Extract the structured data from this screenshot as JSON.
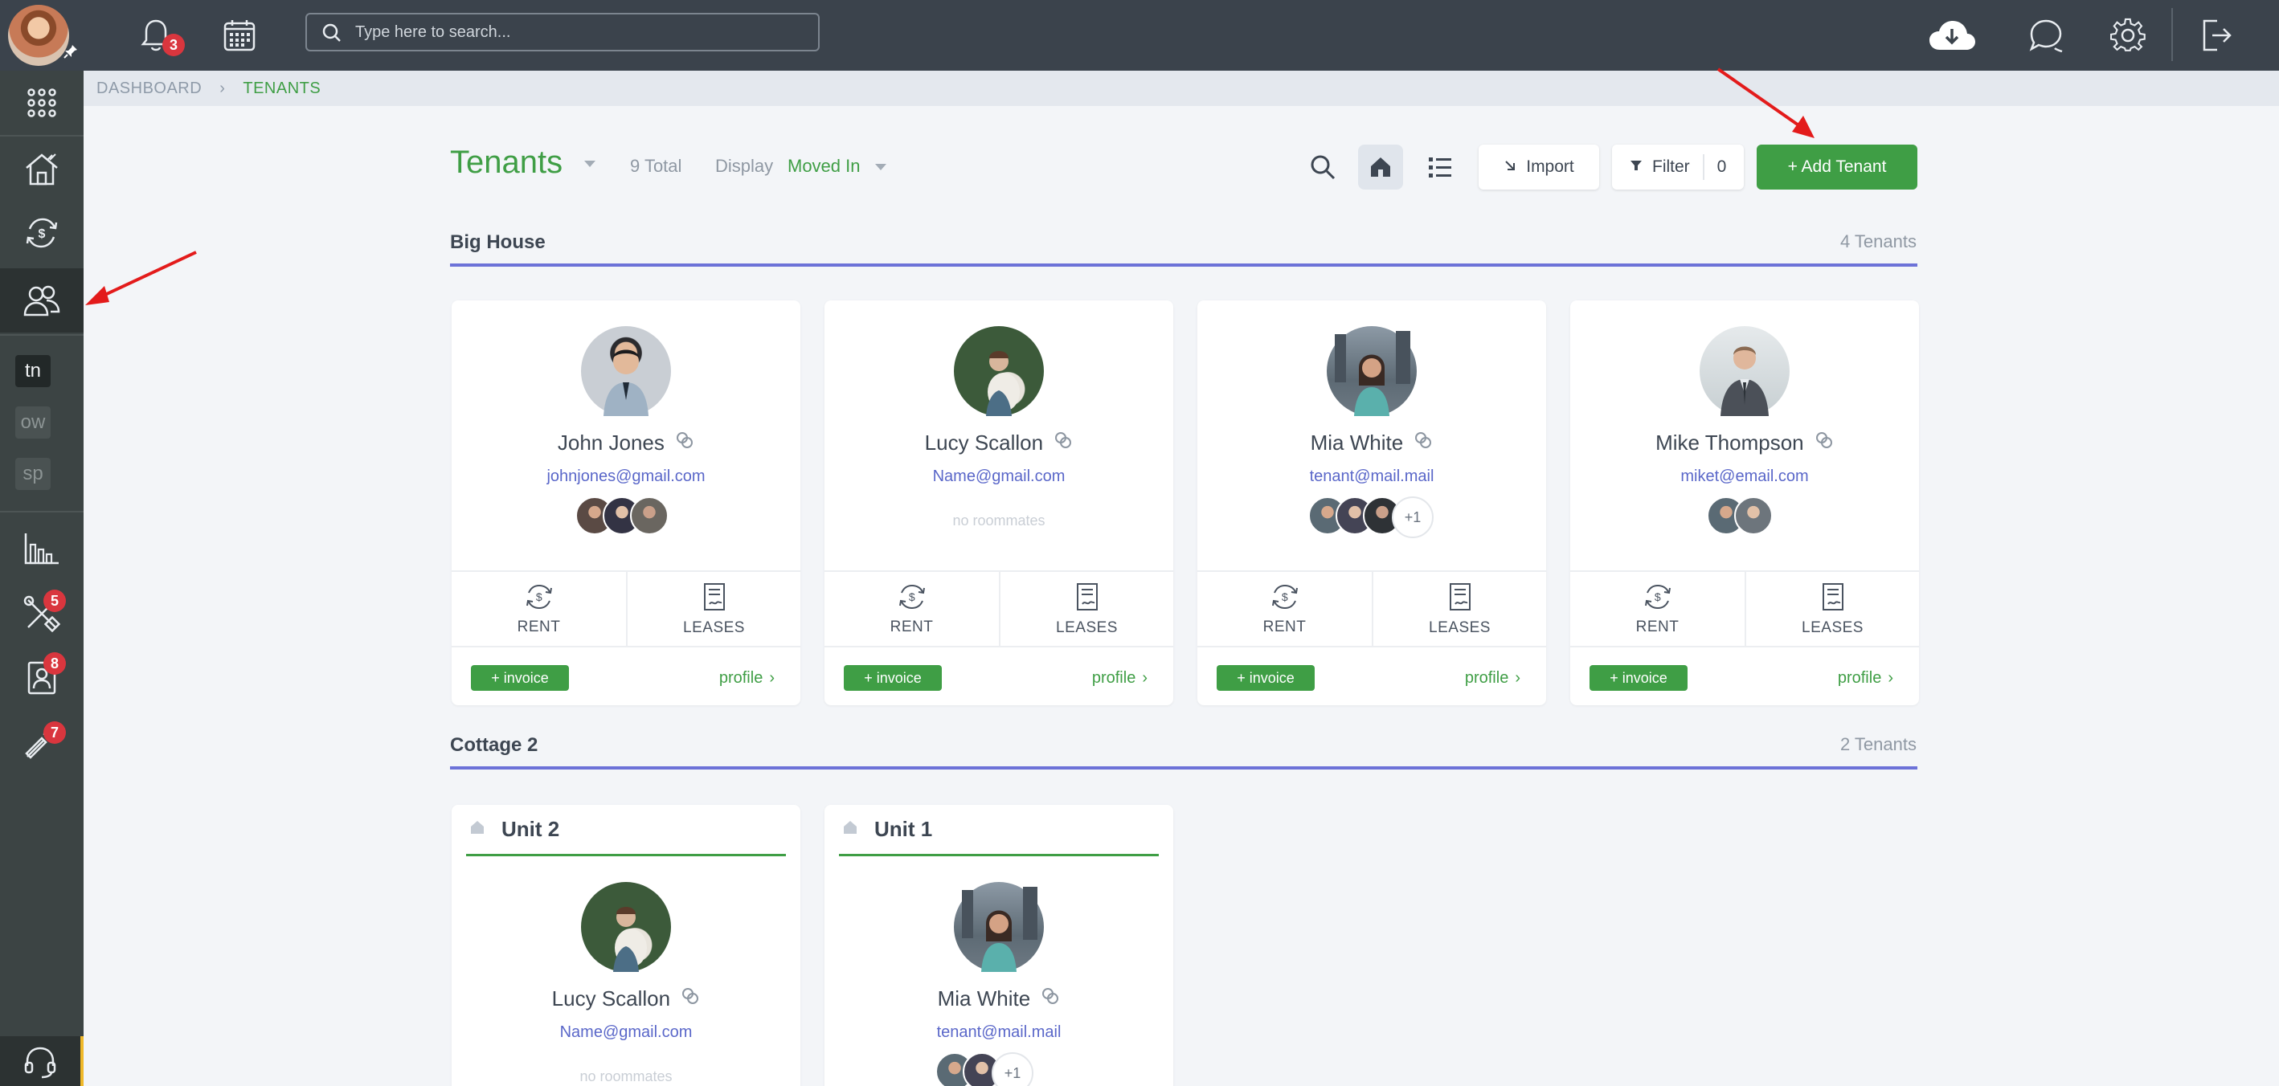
{
  "topbar": {
    "notifications_count": "3",
    "search_placeholder": "Type here to search..."
  },
  "sidebar": {
    "tags": [
      "tn",
      "ow",
      "sp"
    ],
    "maintenance_badge": "5",
    "contacts_badge": "8",
    "tools_badge": "7"
  },
  "breadcrumb": {
    "dashboard": "DASHBOARD",
    "current": "TENANTS"
  },
  "header": {
    "title": "Tenants",
    "total": "9 Total",
    "display_label": "Display",
    "display_value": "Moved In",
    "import_label": "Import",
    "filter_label": "Filter",
    "filter_count": "0",
    "add_tenant_label": "+ Add Tenant"
  },
  "colors": {
    "accent_green": "#3f9e45",
    "section_line": "#6c72d8",
    "topbar": "#3b434c",
    "badge_red": "#d9363e"
  },
  "sections": [
    {
      "title": "Big House",
      "count": "4 Tenants",
      "tenants": [
        {
          "name": "John Jones",
          "email": "johnjones@gmail.com",
          "roommates_note": "",
          "more": ""
        },
        {
          "name": "Lucy Scallon",
          "email": "Name@gmail.com",
          "roommates_note": "no roommates",
          "more": ""
        },
        {
          "name": "Mia White",
          "email": "tenant@mail.mail",
          "roommates_note": "",
          "more": "+1"
        },
        {
          "name": "Mike Thompson",
          "email": "miket@email.com",
          "roommates_note": "",
          "more": ""
        }
      ]
    },
    {
      "title": "Cottage 2",
      "count": "2 Tenants",
      "units": [
        {
          "unit": "Unit 2",
          "name": "Lucy Scallon",
          "email": "Name@gmail.com",
          "roommates_note": "no roommates"
        },
        {
          "unit": "Unit 1",
          "name": "Mia White",
          "email": "tenant@mail.mail",
          "more": "+1"
        }
      ]
    }
  ],
  "card_labels": {
    "rent": "RENT",
    "leases": "LEASES",
    "invoice": "+ invoice",
    "profile": "profile"
  }
}
